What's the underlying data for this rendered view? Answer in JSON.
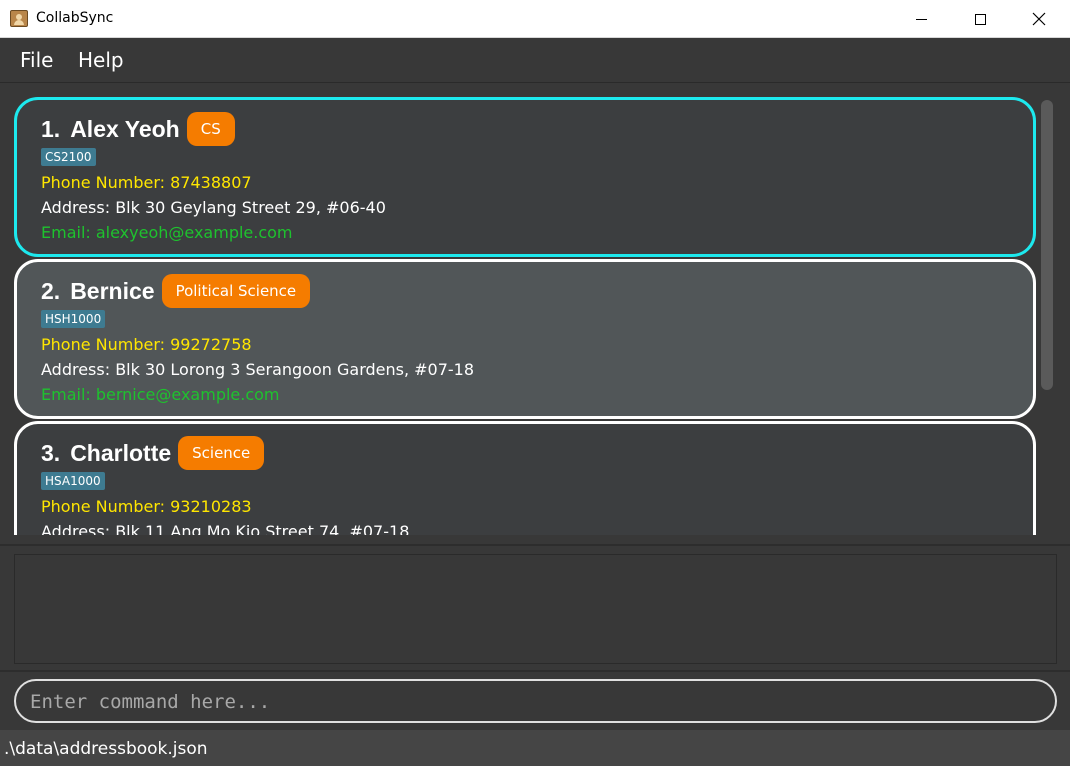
{
  "window": {
    "title": "CollabSync",
    "icon": "address-book-icon"
  },
  "menu": {
    "items": [
      "File",
      "Help"
    ]
  },
  "persons": [
    {
      "index": "1.",
      "name": "Alex Yeoh",
      "major": "CS",
      "module": "CS2100",
      "phone": "Phone Number: 87438807",
      "address": "Address: Blk 30 Geylang Street 29, #06-40",
      "email": "Email: alexyeoh@example.com"
    },
    {
      "index": "2.",
      "name": "Bernice",
      "major": "Political Science",
      "module": "HSH1000",
      "phone": "Phone Number: 99272758",
      "address": "Address: Blk 30 Lorong 3 Serangoon Gardens, #07-18",
      "email": "Email: bernice@example.com"
    },
    {
      "index": "3.",
      "name": "Charlotte",
      "major": "Science",
      "module": "HSA1000",
      "phone": "Phone Number: 93210283",
      "address": "Address: Blk 11 Ang Mo Kio Street 74, #07-18",
      "email": ""
    }
  ],
  "result": {
    "text": ""
  },
  "command": {
    "value": "",
    "placeholder": "Enter command here..."
  },
  "status": {
    "path": ".\\data\\addressbook.json"
  },
  "colors": {
    "selected_border": "#1de9ee",
    "tag": "#f57c00",
    "module": "#3e7b91",
    "phone": "#ffe600",
    "email": "#1ec22e"
  }
}
